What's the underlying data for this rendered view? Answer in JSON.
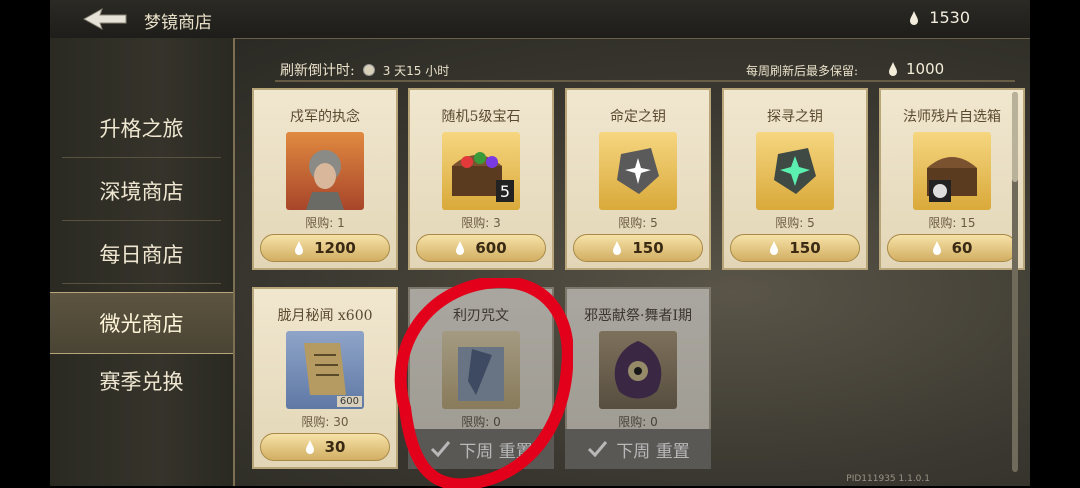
{
  "header": {
    "title": "梦镜商店",
    "currency_amount": "1530"
  },
  "sidebar": {
    "items": [
      {
        "label": "升格之旅"
      },
      {
        "label": "深境商店"
      },
      {
        "label": "每日商店"
      },
      {
        "label": "微光商店"
      },
      {
        "label": "赛季兑换"
      }
    ],
    "active": "微光商店"
  },
  "main": {
    "refresh_label": "刷新倒计时:",
    "refresh_value": "3 天15 小时",
    "cap_label": "每周刷新后最多保留:",
    "cap_value": "1000"
  },
  "items": [
    {
      "name": "戍军的执念",
      "limit": "限购: 1",
      "price": "1200"
    },
    {
      "name": "随机5级宝石",
      "limit": "限购: 3",
      "price": "600",
      "badge": "5"
    },
    {
      "name": "命定之钥",
      "limit": "限购: 5",
      "price": "150"
    },
    {
      "name": "探寻之钥",
      "limit": "限购: 5",
      "price": "150"
    },
    {
      "name": "法师残片自选箱",
      "limit": "限购: 15",
      "price": "60"
    },
    {
      "name": "胧月秘闻 x600",
      "limit": "限购: 30",
      "price": "30",
      "qty": "600"
    },
    {
      "name": "利刃咒文",
      "limit": "限购: 0",
      "reset": "下周 重置"
    },
    {
      "name": "邪恶献祭·舞者I期",
      "limit": "限购: 0",
      "reset": "下周 重置"
    }
  ],
  "footer": {
    "pid": "PID111935  1.1.0.1"
  },
  "colors": {
    "card_bg": "#f0e7cf",
    "price_btn": "#d2ae62",
    "annotation": "#e3001b"
  }
}
